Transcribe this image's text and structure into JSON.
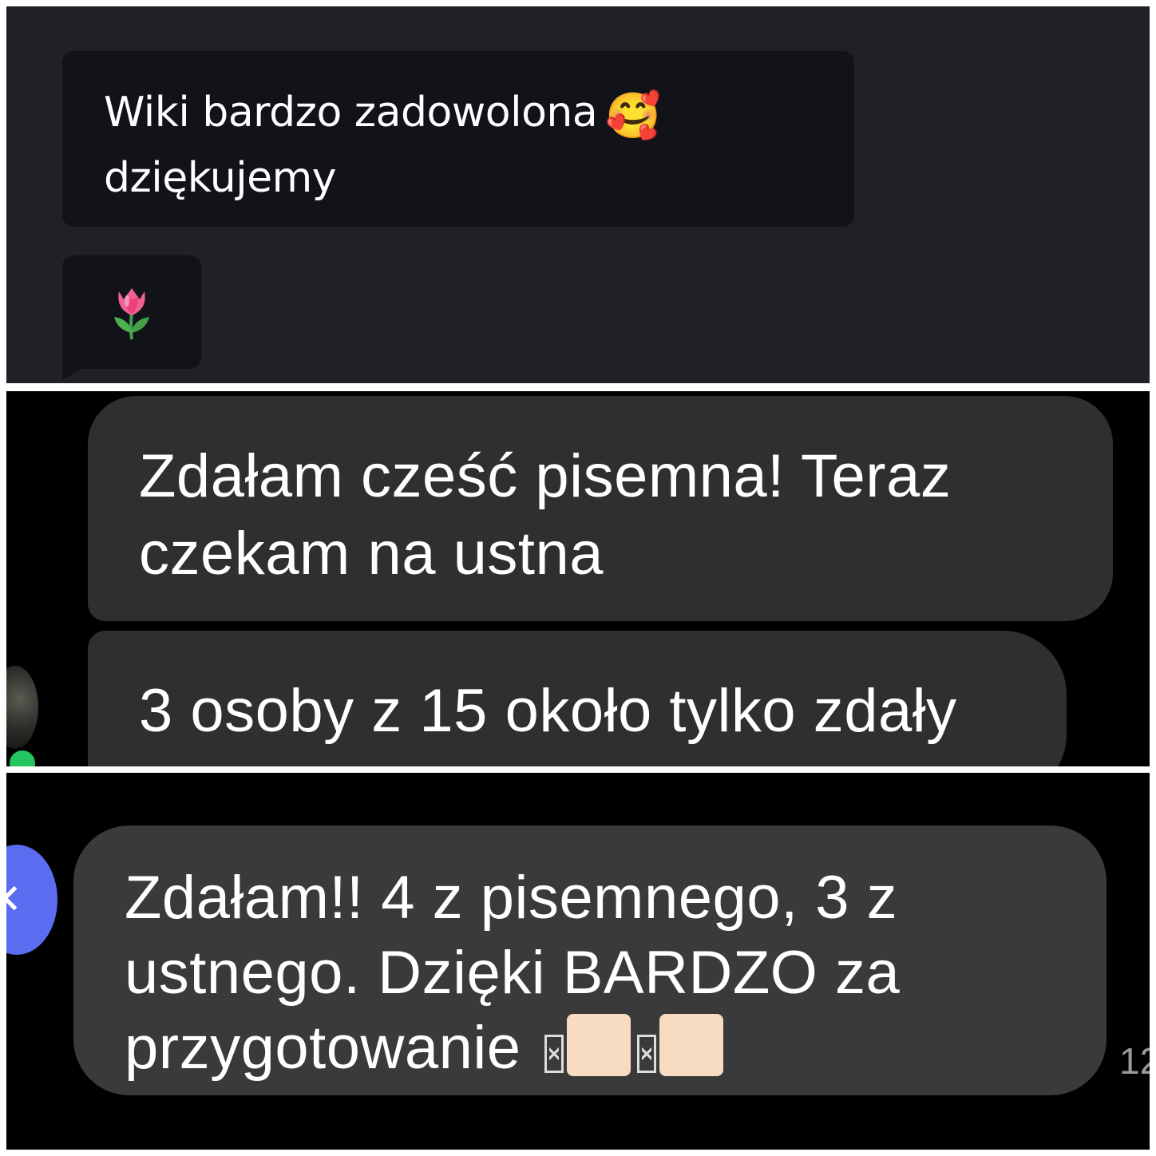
{
  "panel1": {
    "message_text_line1": "Wiki bardzo zadowolona",
    "message_emoji": "🥰",
    "message_text_line2": "dziękujemy",
    "reaction_emoji": "🌷"
  },
  "panel2": {
    "message_a": "Zdałam cześć pisemna! Teraz czekam na ustna",
    "message_b": "3 osoby z 15 około tylko zdały"
  },
  "panel3": {
    "message_line1": "Zdałam!! 4 z pisemnego, 3 z",
    "message_line2": "ustnego. Dzięki BARDZO za",
    "message_line3": "przygotowanie",
    "timestamp_fragment": "12"
  },
  "colors": {
    "panel1_bg": "#202126",
    "panel1_bubble": "#111319",
    "panel2_bubble": "#2f2f2f",
    "panel3_bubble": "#3a3a3a",
    "avatar_blue": "#5b6cf0",
    "online_green": "#22c55e",
    "skin_tone": "#f8dcc1"
  }
}
